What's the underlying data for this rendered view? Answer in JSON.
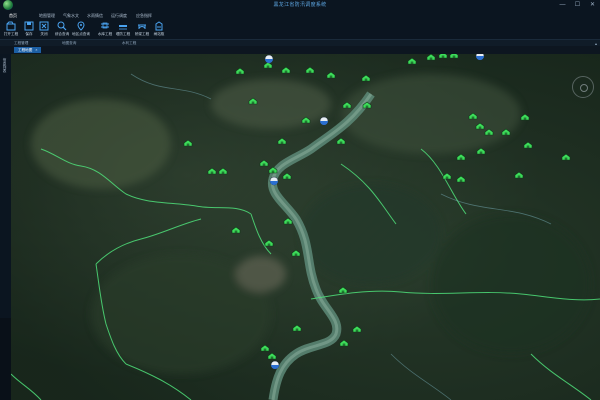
{
  "app": {
    "title": "黑龙江省防汛调度系统"
  },
  "window_controls": [
    {
      "name": "minimize-button",
      "symbol": "—"
    },
    {
      "name": "maximize-button",
      "symbol": "☐"
    },
    {
      "name": "close-button",
      "symbol": "✕"
    }
  ],
  "menu": {
    "items": [
      {
        "label": "首页",
        "active": true
      },
      {
        "label": "地图管理",
        "active": false
      },
      {
        "label": "气象水文",
        "active": false
      },
      {
        "label": "水雨情信",
        "active": false
      },
      {
        "label": "运行调度",
        "active": false
      },
      {
        "label": "应急指挥",
        "active": false
      }
    ]
  },
  "toolbar": {
    "tools": [
      {
        "label": "打开工程",
        "icon": "open-project-icon"
      },
      {
        "label": "保存",
        "icon": "save-icon"
      },
      {
        "label": "关闭",
        "icon": "close-project-icon"
      },
      {
        "label": "综合查询",
        "icon": "search-icon"
      },
      {
        "label": "地区点查询",
        "icon": "location-pin-icon"
      },
      {
        "label": "水库工程",
        "icon": "reservoir-icon"
      },
      {
        "label": "堤防工程",
        "icon": "dike-icon"
      },
      {
        "label": "桥梁工程",
        "icon": "bridge-icon"
      },
      {
        "label": "闸站枢",
        "icon": "sluice-icon"
      }
    ]
  },
  "groups": {
    "labels": [
      "工程管理",
      "地图查询",
      "水利工程"
    ]
  },
  "layer_tab": {
    "label": "工程地图",
    "close": "×"
  },
  "side_panel": {
    "label": "信息列表"
  },
  "colors": {
    "accent": "#2d8ee0",
    "marker_green": "#3ddc5a",
    "marker_blue": "#2a6fd0",
    "river": "#5a8f7c",
    "boundary": "#4fe07a"
  },
  "markers": {
    "reservoir_icon": "reservoir-marker-icon",
    "station_icon": "hydro-station-marker-icon"
  }
}
